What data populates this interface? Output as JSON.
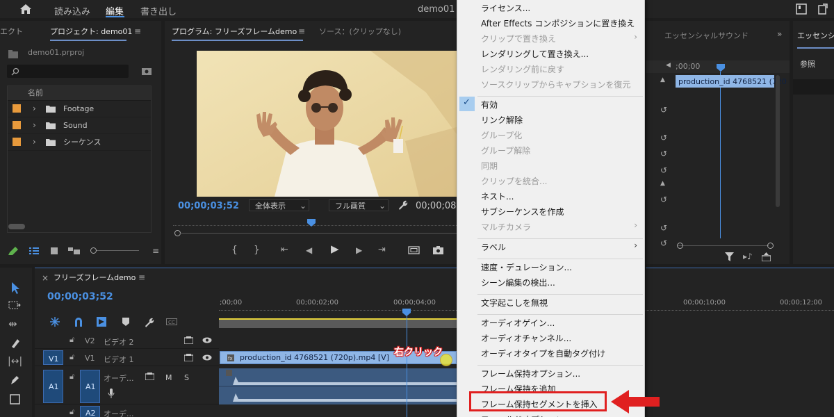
{
  "topbar": {
    "tabs": [
      "読み込み",
      "編集",
      "書き出し"
    ],
    "doc_title": "demo01 -"
  },
  "project": {
    "edge_tab": "エクト",
    "tab_label": "プロジェクト: demo01",
    "filename": "demo01.prproj",
    "col_name": "名前",
    "items": [
      "Footage",
      "Sound",
      "シーケンス"
    ]
  },
  "program": {
    "tab_label": "プログラム: フリーズフレームdemo",
    "source_label": "ソース：(クリップなし)",
    "timecode": "00;00;03;52",
    "zoom": "全体表示",
    "quality": "フル画質",
    "duration_partial": "00;00;08;"
  },
  "right_panels": {
    "essential_sound": "エッセンシャルサウンド",
    "essential_graphics": "エッセンシャ",
    "browse": "参照",
    "mini_ruler": ";00;00",
    "mini_clip": "production_id 4768521 (720"
  },
  "context_menu": {
    "items": [
      {
        "label": "ライセンス...",
        "disabled": false
      },
      {
        "label": "After Effects コンポジションに置き換え",
        "disabled": false
      },
      {
        "label": "クリップで置き換え",
        "disabled": true,
        "submenu": true
      },
      {
        "label": "レンダリングして置き換え...",
        "disabled": false
      },
      {
        "label": "レンダリング前に戻す",
        "disabled": true
      },
      {
        "label": "ソースクリップからキャプションを復元",
        "disabled": true
      },
      {
        "label": "有効",
        "disabled": false,
        "checked": true
      },
      {
        "label": "リンク解除",
        "disabled": false
      },
      {
        "label": "グループ化",
        "disabled": true
      },
      {
        "label": "グループ解除",
        "disabled": true
      },
      {
        "label": "同期",
        "disabled": true
      },
      {
        "label": "クリップを統合...",
        "disabled": true
      },
      {
        "label": "ネスト...",
        "disabled": false
      },
      {
        "label": "サブシーケンスを作成",
        "disabled": false
      },
      {
        "label": "マルチカメラ",
        "disabled": true,
        "submenu": true
      },
      {
        "label": "ラベル",
        "disabled": false,
        "submenu": true
      },
      {
        "label": "速度・デュレーション...",
        "disabled": false
      },
      {
        "label": "シーン編集の検出...",
        "disabled": false
      },
      {
        "label": "文字起こしを無視",
        "disabled": false
      },
      {
        "label": "オーディオゲイン...",
        "disabled": false
      },
      {
        "label": "オーディオチャンネル...",
        "disabled": false
      },
      {
        "label": "オーディオタイプを自動タグ付け",
        "disabled": false
      },
      {
        "label": "フレーム保持オプション...",
        "disabled": false
      },
      {
        "label": "フレーム保持を追加",
        "disabled": false
      },
      {
        "label": "フレーム保持セグメントを挿入",
        "disabled": false,
        "highlighted": true
      },
      {
        "label": "フィールドオプション...",
        "disabled": false
      }
    ]
  },
  "timeline": {
    "tab_label": "フリーズフレームdemo",
    "timecode": "00;00;03;52",
    "ruler": [
      ";00;00",
      "00;00;02;00",
      "00;00;04;00",
      "00;00;10;00",
      "00;00;12;00"
    ],
    "tracks": {
      "v2_src": "V2",
      "v2_name": "ビデオ 2",
      "v1_target": "V1",
      "v1_src": "V1",
      "v1_name": "ビデオ 1",
      "a1_target": "A1",
      "a1_src": "A1",
      "a1_name": "オーデ...",
      "a2_src": "A2",
      "a2_name": "オーデ...",
      "mute": "M",
      "solo": "S"
    },
    "clip_name": "production_id 4768521 (720p).mp4 [V]"
  },
  "annotation": {
    "right_click": "右クリック",
    "arrow_color": "#e02020"
  },
  "colors": {
    "accent_blue": "#4a90e2",
    "folder_orange": "#e89a3c",
    "highlight_red": "#e02020"
  }
}
